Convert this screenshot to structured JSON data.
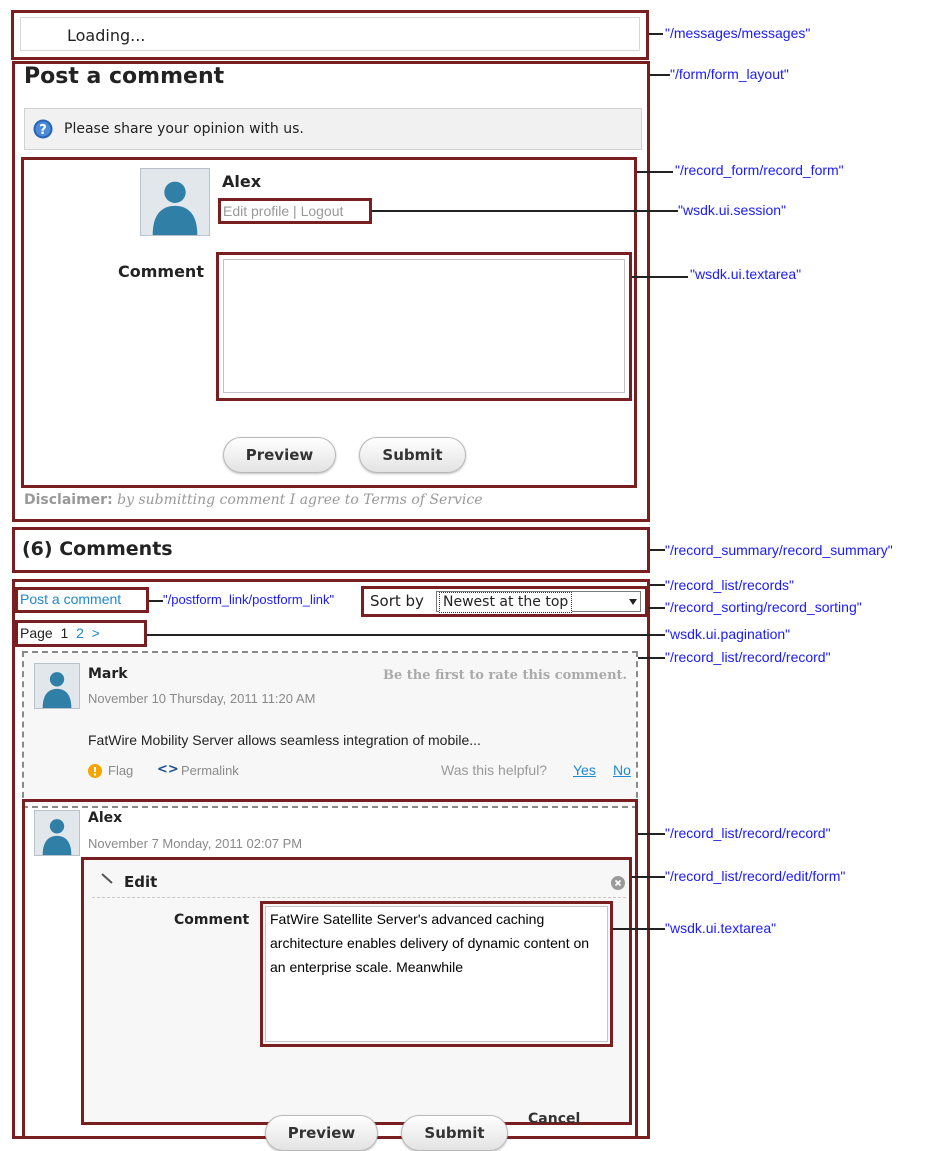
{
  "messages": {
    "text": "Loading..."
  },
  "form": {
    "title": "Post a comment",
    "info_text": "Please share your opinion with us.",
    "user_name": "Alex",
    "session": {
      "edit_profile": "Edit profile",
      "separator": "|",
      "logout": "Logout"
    },
    "comment_label": "Comment",
    "comment_value": "",
    "preview_label": "Preview",
    "submit_label": "Submit",
    "disclaimer_bold": "Disclaimer:",
    "disclaimer_text": "by submitting comment I agree to Terms of Service"
  },
  "summary": {
    "title": "(6) Comments"
  },
  "list": {
    "postform_link": "Post a comment",
    "sort_label": "Sort by",
    "sort_selected": "Newest at the top",
    "pagination": {
      "label": "Page",
      "current": "1",
      "next_page": "2",
      "next_arrow": ">"
    }
  },
  "records": [
    {
      "author": "Mark",
      "rating_text": "Be the first to rate this comment.",
      "date": "November 10 Thursday, 2011 11:20 AM",
      "body": "FatWire Mobility Server allows seamless integration of mobile...",
      "flag": "Flag",
      "permalink_icon": "<>",
      "permalink": "Permalink",
      "helpful": "Was this helpful?",
      "yes": "Yes",
      "no": "No"
    },
    {
      "author": "Alex",
      "date": "November 7 Monday, 2011 02:07 PM",
      "edit": {
        "title": "Edit",
        "comment_label": "Comment",
        "comment_value": "FatWire Satellite Server's advanced caching architecture enables delivery of dynamic content on an enterprise scale. Meanwhile",
        "preview_label": "Preview",
        "submit_label": "Submit",
        "cancel_label": "Cancel"
      }
    }
  ],
  "annotations": {
    "messages": "\"/messages/messages\"",
    "form_layout": "\"/form/form_layout\"",
    "record_form": "\"/record_form/record_form\"",
    "session": "\"wsdk.ui.session\"",
    "textarea": "\"wsdk.ui.textarea\"",
    "record_summary": "\"/record_summary/record_summary\"",
    "records": "\"/record_list/records\"",
    "postform_link": "\"/postform_link/postform_link\"",
    "record_sorting": "\"/record_sorting/record_sorting\"",
    "pagination": "\"wsdk.ui.pagination\"",
    "record": "\"/record_list/record/record\"",
    "edit_form": "\"/record_list/record/edit/form\"",
    "textarea2": "\"wsdk.ui.textarea\""
  },
  "colors": {
    "frame": "#7a1f1f",
    "annotation": "#1a1aff",
    "link": "#1e88d0",
    "flag": "#f5a400"
  },
  "icons": [
    "help-icon",
    "avatar-icon",
    "flag-icon",
    "permalink-icon",
    "pencil-icon",
    "close-circle-icon",
    "dropdown-arrow-icon"
  ]
}
